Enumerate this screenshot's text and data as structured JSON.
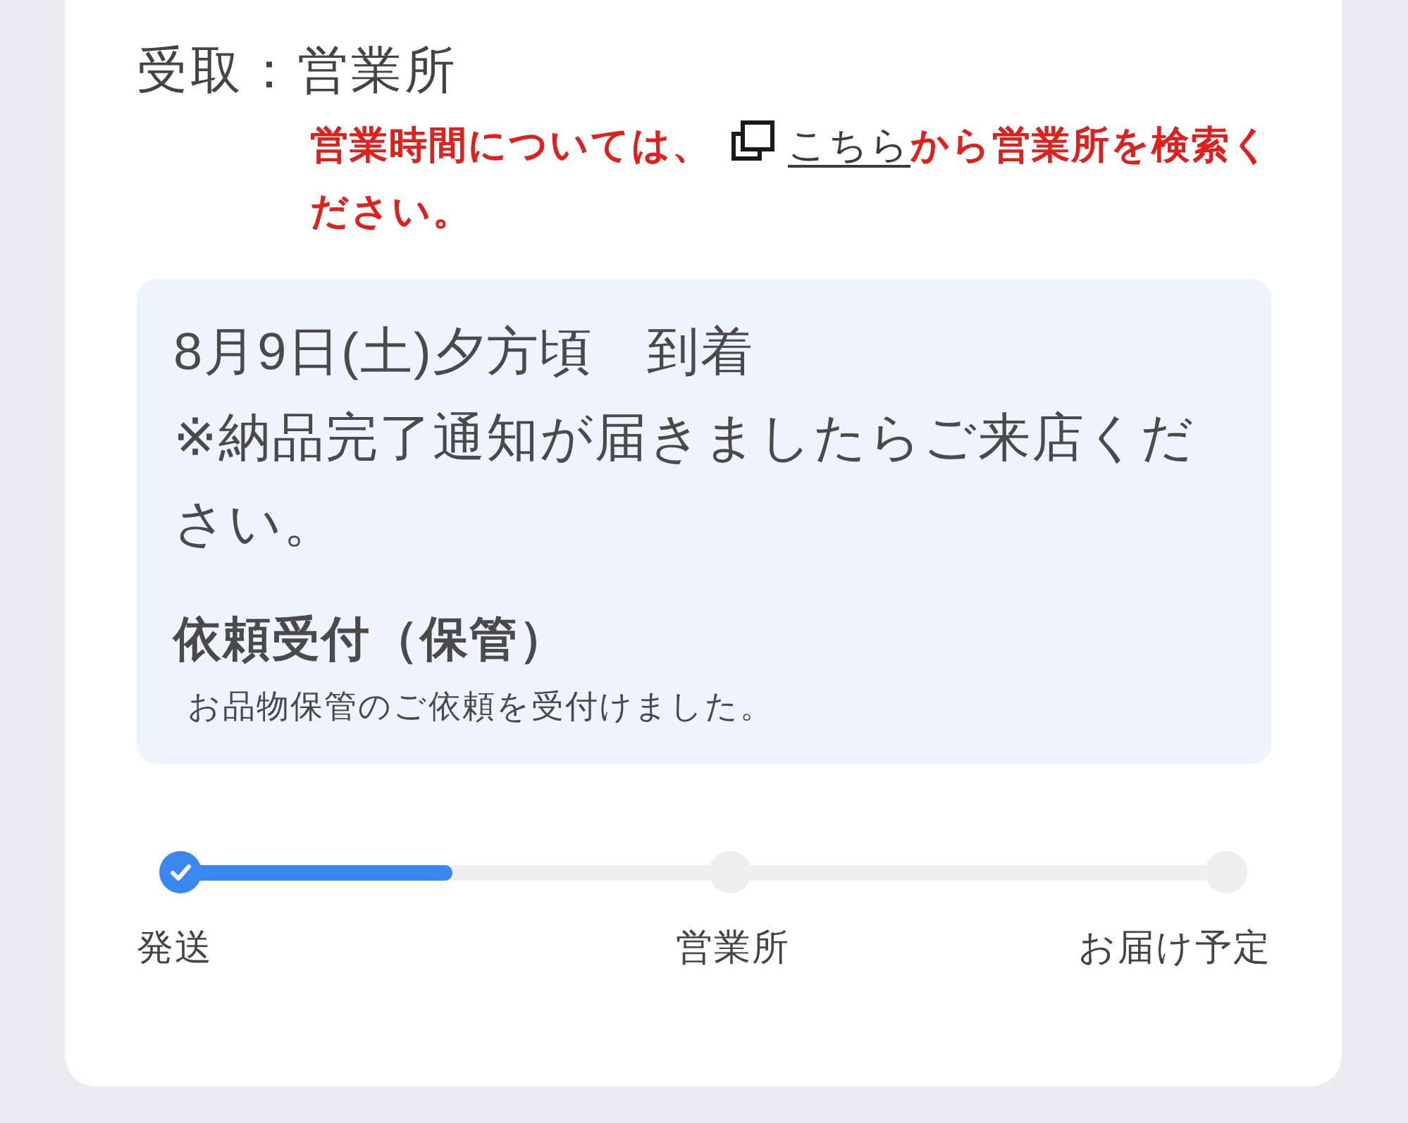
{
  "pickup": {
    "label": "受取：営業所"
  },
  "note": {
    "text_before": "営業時間については、",
    "link": "こちら",
    "text_after": "から営業所を検索ください。"
  },
  "status_box": {
    "arrival": "8月9日(土)夕方頃　到着",
    "instruction": "※納品完了通知が届きましたらご来店ください。",
    "status_title": "依頼受付（保管）",
    "status_detail": "お品物保管のご依頼を受付けました。"
  },
  "progress": {
    "level": 0.26,
    "steps": [
      {
        "label": "発送",
        "done": true
      },
      {
        "label": "営業所",
        "done": false
      },
      {
        "label": "お届け予定",
        "done": false
      }
    ]
  }
}
